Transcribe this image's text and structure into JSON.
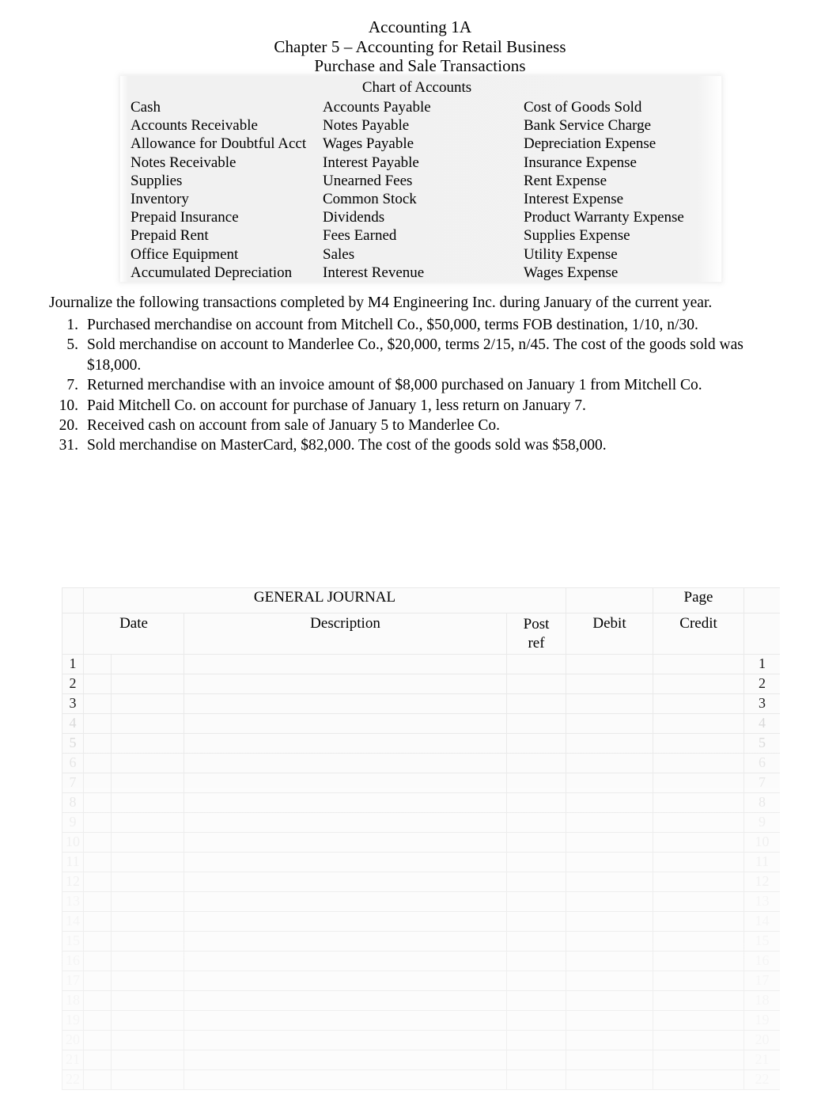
{
  "document": {
    "titles": [
      "Accounting 1A",
      "Chapter 5 – Accounting for Retail Business",
      "Purchase and Sale Transactions"
    ]
  },
  "chart_of_accounts": {
    "heading": "Chart of Accounts",
    "column1": [
      "Cash",
      "Accounts Receivable",
      "Allowance for Doubtful Acct",
      "Notes Receivable",
      "Supplies",
      "Inventory",
      "Prepaid Insurance",
      "Prepaid Rent",
      "Office Equipment",
      "Accumulated Depreciation"
    ],
    "column2": [
      "Accounts Payable",
      "Notes Payable",
      "Wages Payable",
      "Interest Payable",
      "Unearned Fees",
      "Common Stock",
      "Dividends",
      "Fees Earned",
      "Sales",
      "Interest Revenue"
    ],
    "column3": [
      "Cost of Goods Sold",
      "Bank Service Charge",
      "Depreciation Expense",
      "Insurance Expense",
      "Rent Expense",
      "Interest Expense",
      "Product Warranty Expense",
      "Supplies Expense",
      "Utility Expense",
      "Wages Expense"
    ]
  },
  "instructions": {
    "text": "Journalize the following transactions completed by M4 Engineering Inc. during January of the current year."
  },
  "transactions": [
    {
      "day": "1.",
      "text": "Purchased merchandise on account from Mitchell Co., $50,000, terms FOB destination, 1/10, n/30."
    },
    {
      "day": "5.",
      "text": "Sold merchandise on account to Manderlee Co., $20,000, terms 2/15, n/45. The cost of the goods sold was $18,000."
    },
    {
      "day": "7.",
      "text": "Returned merchandise with an invoice amount of $8,000 purchased on January 1 from Mitchell Co."
    },
    {
      "day": "10.",
      "text": "Paid Mitchell Co. on account for purchase of January 1, less return on January 7."
    },
    {
      "day": "20.",
      "text": "Received cash on account from sale of January 5 to Manderlee Co."
    },
    {
      "day": "31.",
      "text": "Sold merchandise on MasterCard, $82,000. The cost of the goods sold was $58,000."
    }
  ],
  "general_journal": {
    "title": "GENERAL JOURNAL",
    "page_label": "Page",
    "page_number": "",
    "headers": {
      "date": "Date",
      "description": "Description",
      "post_ref": "Post ref",
      "post_ref_line1": "Post",
      "post_ref_line2": "ref",
      "debit": "Debit",
      "credit": "Credit"
    },
    "line_numbers": [
      "1",
      "2",
      "3",
      "4",
      "5",
      "6",
      "7",
      "8",
      "9",
      "10",
      "11",
      "12",
      "13",
      "14",
      "15",
      "16",
      "17",
      "18",
      "19",
      "20",
      "21",
      "22"
    ],
    "rows": [
      {
        "n": "1",
        "date_a": "",
        "date_b": "",
        "description": "",
        "post_ref": "",
        "debit": "",
        "credit": ""
      },
      {
        "n": "2",
        "date_a": "",
        "date_b": "",
        "description": "",
        "post_ref": "",
        "debit": "",
        "credit": ""
      },
      {
        "n": "3",
        "date_a": "",
        "date_b": "",
        "description": "",
        "post_ref": "",
        "debit": "",
        "credit": ""
      },
      {
        "n": "4",
        "date_a": "",
        "date_b": "",
        "description": "",
        "post_ref": "",
        "debit": "",
        "credit": ""
      },
      {
        "n": "5",
        "date_a": "",
        "date_b": "",
        "description": "",
        "post_ref": "",
        "debit": "",
        "credit": ""
      },
      {
        "n": "6",
        "date_a": "",
        "date_b": "",
        "description": "",
        "post_ref": "",
        "debit": "",
        "credit": ""
      },
      {
        "n": "7",
        "date_a": "",
        "date_b": "",
        "description": "",
        "post_ref": "",
        "debit": "",
        "credit": ""
      },
      {
        "n": "8",
        "date_a": "",
        "date_b": "",
        "description": "",
        "post_ref": "",
        "debit": "",
        "credit": ""
      },
      {
        "n": "9",
        "date_a": "",
        "date_b": "",
        "description": "",
        "post_ref": "",
        "debit": "",
        "credit": ""
      },
      {
        "n": "10",
        "date_a": "",
        "date_b": "",
        "description": "",
        "post_ref": "",
        "debit": "",
        "credit": ""
      },
      {
        "n": "11",
        "date_a": "",
        "date_b": "",
        "description": "",
        "post_ref": "",
        "debit": "",
        "credit": ""
      },
      {
        "n": "12",
        "date_a": "",
        "date_b": "",
        "description": "",
        "post_ref": "",
        "debit": "",
        "credit": ""
      },
      {
        "n": "13",
        "date_a": "",
        "date_b": "",
        "description": "",
        "post_ref": "",
        "debit": "",
        "credit": ""
      },
      {
        "n": "14",
        "date_a": "",
        "date_b": "",
        "description": "",
        "post_ref": "",
        "debit": "",
        "credit": ""
      },
      {
        "n": "15",
        "date_a": "",
        "date_b": "",
        "description": "",
        "post_ref": "",
        "debit": "",
        "credit": ""
      },
      {
        "n": "16",
        "date_a": "",
        "date_b": "",
        "description": "",
        "post_ref": "",
        "debit": "",
        "credit": ""
      },
      {
        "n": "17",
        "date_a": "",
        "date_b": "",
        "description": "",
        "post_ref": "",
        "debit": "",
        "credit": ""
      },
      {
        "n": "18",
        "date_a": "",
        "date_b": "",
        "description": "",
        "post_ref": "",
        "debit": "",
        "credit": ""
      },
      {
        "n": "19",
        "date_a": "",
        "date_b": "",
        "description": "",
        "post_ref": "",
        "debit": "",
        "credit": ""
      },
      {
        "n": "20",
        "date_a": "",
        "date_b": "",
        "description": "",
        "post_ref": "",
        "debit": "",
        "credit": ""
      },
      {
        "n": "21",
        "date_a": "",
        "date_b": "",
        "description": "",
        "post_ref": "",
        "debit": "",
        "credit": ""
      },
      {
        "n": "22",
        "date_a": "",
        "date_b": "",
        "description": "",
        "post_ref": "",
        "debit": "",
        "credit": ""
      }
    ]
  },
  "colors": {
    "page_background": "#ffffff",
    "text": "#000000",
    "table_fill": "#fbfbfb",
    "grid_line": "#e9e9e9",
    "coa_fill": "#f1f1f1"
  }
}
